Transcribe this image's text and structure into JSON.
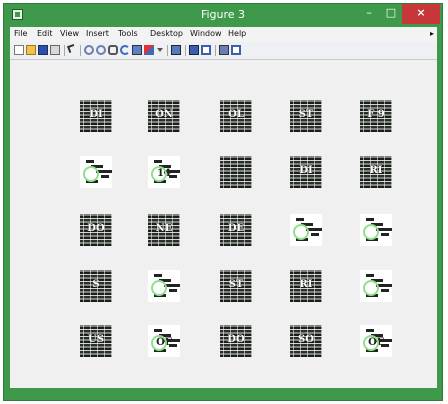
{
  "window": {
    "title": "Figure 3",
    "close_glyph": "×",
    "min_glyph": "–",
    "max_glyph": "□"
  },
  "menu": [
    "File",
    "Edit",
    "View",
    "Insert",
    "Tools",
    "Desktop",
    "Window",
    "Help"
  ],
  "menu_arrow": "▸",
  "toolbar_icons": [
    "new-figure-icon",
    "open-file-icon",
    "save-icon",
    "print-icon",
    "select-arrow-icon",
    "zoom-in-icon",
    "zoom-out-icon",
    "pan-icon",
    "rotate-3d-icon",
    "data-cursor-icon",
    "brush-icon",
    "link-plot-icon",
    "colorbar-icon",
    "legend-icon",
    "hide-plot-tools-icon",
    "show-plot-tools-icon"
  ],
  "grid": [
    [
      {
        "text": "DI",
        "ring": false
      },
      {
        "text": "ON",
        "ring": false
      },
      {
        "text": "OL",
        "ring": false
      },
      {
        "text": "ST",
        "ring": false
      },
      {
        "text": "F 9",
        "ring": false
      }
    ],
    [
      {
        "text": "",
        "ring": true
      },
      {
        "text": "14",
        "ring": true
      },
      {
        "text": "",
        "ring": false
      },
      {
        "text": "DI",
        "ring": false
      },
      {
        "text": "RI",
        "ring": false
      }
    ],
    [
      {
        "text": "DO",
        "ring": false
      },
      {
        "text": "NE",
        "ring": false
      },
      {
        "text": "DE",
        "ring": false
      },
      {
        "text": "",
        "ring": true
      },
      {
        "text": "",
        "ring": true
      }
    ],
    [
      {
        "text": "S",
        "ring": false
      },
      {
        "text": "",
        "ring": true
      },
      {
        "text": "ST",
        "ring": false
      },
      {
        "text": "RI",
        "ring": false
      },
      {
        "text": "",
        "ring": true
      }
    ],
    [
      {
        "text": "US",
        "ring": false
      },
      {
        "text": "OF",
        "ring": true
      },
      {
        "text": "DO",
        "ring": false
      },
      {
        "text": "SO",
        "ring": false
      },
      {
        "text": "OF",
        "ring": true
      }
    ]
  ]
}
